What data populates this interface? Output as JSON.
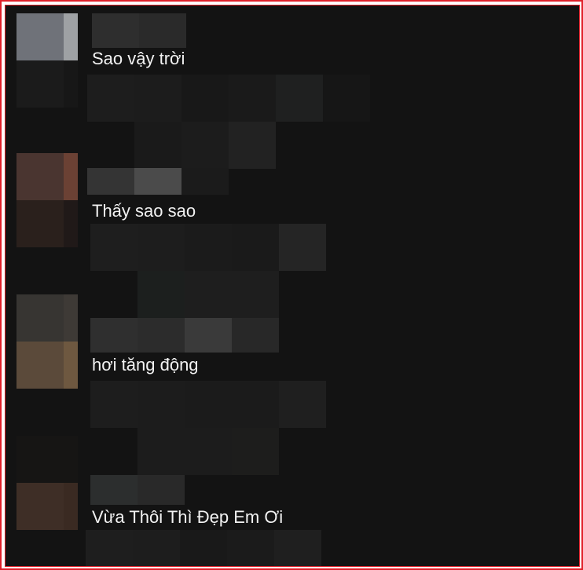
{
  "comments": [
    {
      "text": "Sao vậy trời"
    },
    {
      "text": "Thấy sao sao"
    },
    {
      "text": "hơi tăng động"
    },
    {
      "text": "Vừa Thôi Thì Đẹp Em Ơi"
    }
  ],
  "colors": {
    "frame_border": "#e0202a",
    "background": "#131313",
    "text": "#f2f2f2"
  }
}
